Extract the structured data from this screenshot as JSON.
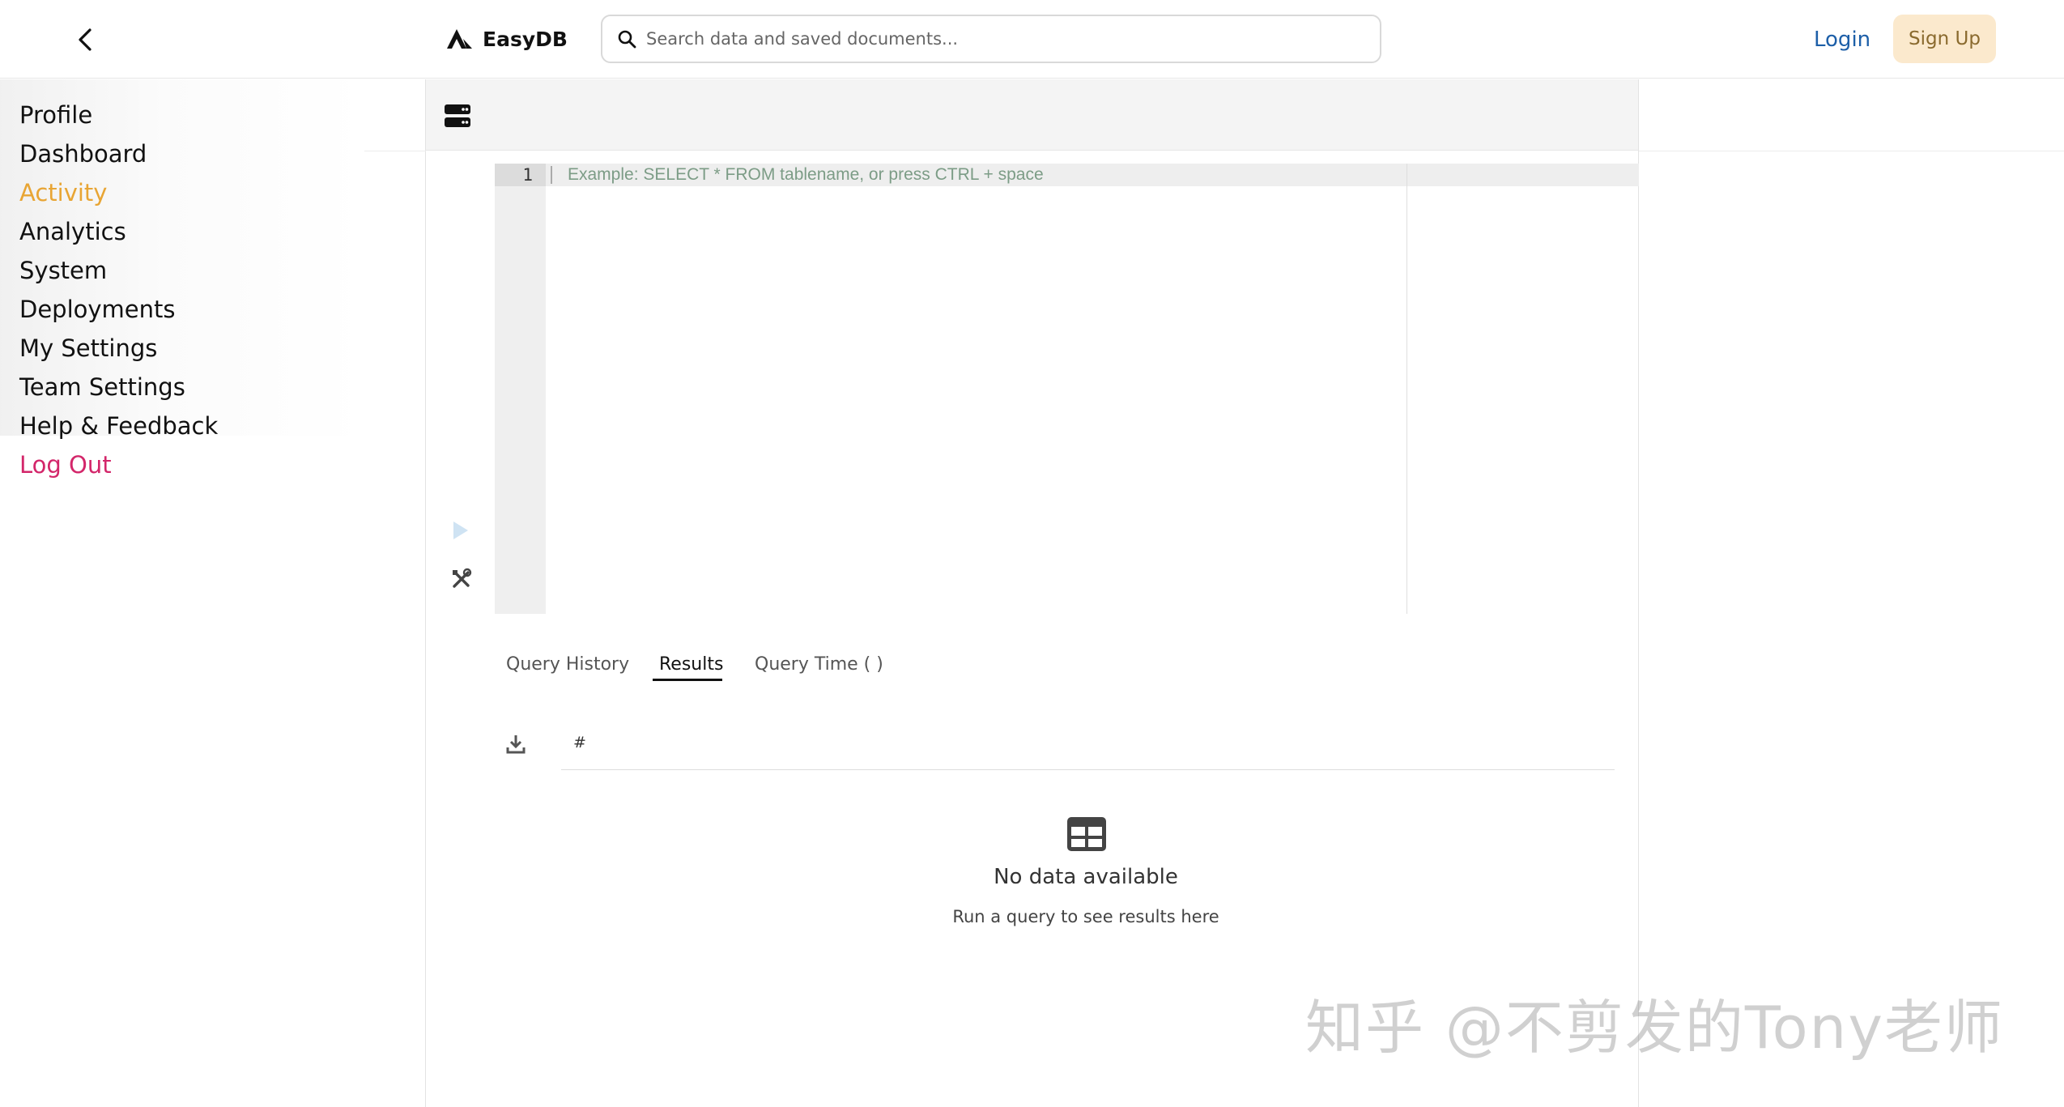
{
  "header": {
    "brand_name": "EasyDB",
    "search_placeholder": "Search data and saved documents...",
    "login_label": "Login",
    "signup_label": "Sign Up"
  },
  "sidebar": {
    "items": [
      {
        "label": "Profile"
      },
      {
        "label": "Dashboard"
      },
      {
        "label": "Activity",
        "active": true
      },
      {
        "label": "Analytics"
      },
      {
        "label": "System"
      },
      {
        "label": "Deployments"
      },
      {
        "label": "My Settings"
      },
      {
        "label": "Team Settings"
      },
      {
        "label": "Help & Feedback"
      },
      {
        "label": "Log Out"
      }
    ]
  },
  "editor": {
    "line_number": "1",
    "placeholder": "Example: SELECT * FROM tablename, or press CTRL + space"
  },
  "tabs": [
    {
      "label": "Query History"
    },
    {
      "label": "Results",
      "active": true
    },
    {
      "label": "Query Time ( )"
    }
  ],
  "results": {
    "column_header": "#",
    "empty_title": "No data available",
    "empty_subtitle": "Run a query to see results here"
  },
  "watermark": "知乎 @不剪发的Tony老师",
  "colors": {
    "active_nav": "#e8a534",
    "logout": "#d3266a",
    "login_link": "#1d5fa8",
    "signup_bg": "#fbe9cd",
    "placeholder_text": "#7c9c86",
    "run_icon": "#cfe3f3"
  },
  "icons": {
    "back": "chevron-left-icon",
    "brand": "logo-icon",
    "search": "search-icon",
    "database": "database-icon",
    "run": "play-icon",
    "tools": "tools-icon",
    "download": "download-icon",
    "empty": "table-icon"
  }
}
